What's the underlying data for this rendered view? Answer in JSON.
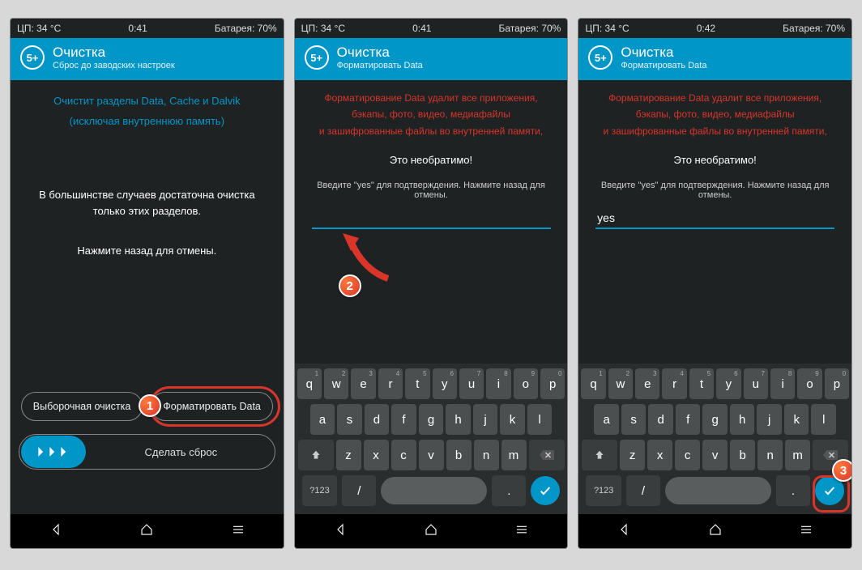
{
  "screens": [
    {
      "status": {
        "cpu": "ЦП: 34 °C",
        "time": "0:41",
        "battery": "Батарея: 70%"
      },
      "header": {
        "icon": "5+",
        "title": "Очистка",
        "subtitle": "Сброс до заводских настроек"
      },
      "info_blue_1": "Очистит разделы Data, Cache и Dalvik",
      "info_blue_2": "(исключая внутреннюю память)",
      "paragraph_1": "В большинстве случаев достаточна очистка только этих разделов.",
      "paragraph_2": "Нажмите назад для отмены.",
      "btn_selective": "Выборочная очистка",
      "btn_format": "Форматировать Data",
      "swipe_label": "Сделать сброс"
    },
    {
      "status": {
        "cpu": "ЦП: 34 °C",
        "time": "0:41",
        "battery": "Батарея: 70%"
      },
      "header": {
        "icon": "5+",
        "title": "Очистка",
        "subtitle": "Форматировать Data"
      },
      "warn_1": "Форматирование Data удалит все приложения,",
      "warn_2": "бэкапы, фото, видео, медиафайлы",
      "warn_3": "и зашифрованные файлы во внутренней памяти,",
      "irreversible": "Это необратимо!",
      "prompt": "Введите \"yes\" для подтверждения. Нажмите назад для отмены.",
      "input_value": ""
    },
    {
      "status": {
        "cpu": "ЦП: 34 °C",
        "time": "0:42",
        "battery": "Батарея: 70%"
      },
      "header": {
        "icon": "5+",
        "title": "Очистка",
        "subtitle": "Форматировать Data"
      },
      "warn_1": "Форматирование Data удалит все приложения,",
      "warn_2": "бэкапы, фото, видео, медиафайлы",
      "warn_3": "и зашифрованные файлы во внутренней памяти,",
      "irreversible": "Это необратимо!",
      "prompt": "Введите \"yes\" для подтверждения. Нажмите назад для отмены.",
      "input_value": "yes"
    }
  ],
  "keyboard": {
    "row1": [
      "q",
      "w",
      "e",
      "r",
      "t",
      "y",
      "u",
      "i",
      "o",
      "p"
    ],
    "nums": [
      "1",
      "2",
      "3",
      "4",
      "5",
      "6",
      "7",
      "8",
      "9",
      "0"
    ],
    "row2": [
      "a",
      "s",
      "d",
      "f",
      "g",
      "h",
      "j",
      "k",
      "l"
    ],
    "row3": [
      "z",
      "x",
      "c",
      "v",
      "b",
      "n",
      "m"
    ],
    "sym_key": "?123",
    "slash": "/",
    "dot": "."
  },
  "annotations": {
    "badge1": "1",
    "badge2": "2",
    "badge3": "3"
  }
}
